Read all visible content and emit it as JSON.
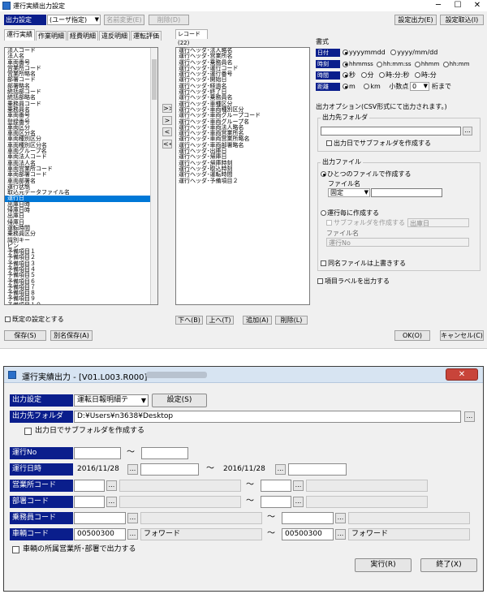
{
  "window1": {
    "title": "運行実績出力設定",
    "toolbar": {
      "output_setting_label": "出力設定",
      "output_setting_value": "(ユーザ指定)",
      "rename_button": "名前変更(E)",
      "delete_button": "削除(D)",
      "output_config_button": "設定出力(E)",
      "import_config_button": "設定取込(I)"
    },
    "tabs": [
      "運行実績",
      "作業明細",
      "経費明細",
      "違反明細",
      "運転評価"
    ],
    "source_list": [
      "法人コード",
      "法人名",
      "車両番号",
      "営業所コード",
      "営業所略名",
      "部署コード",
      "部署略名",
      "統括部コード",
      "統括部略名",
      "乗務員コード",
      "乗務員名",
      "車両番号",
      "登録番号",
      "車両区分",
      "車両区分名",
      "車両種別区分",
      "車両種別区分名",
      "車両グループ名",
      "車両法人コード",
      "車両法人名",
      "車両営業所コード",
      "車両部署コード",
      "車両部署名",
      "運行状態",
      "取込元データファイル名",
      "運行日",
      "出庫日時",
      "帰庫日時",
      "出庫日",
      "帰庫日",
      "運転時間",
      "乗務員区分",
      "識別キー",
      "ピン",
      "予備項目１",
      "予備項目２",
      "予備項目３",
      "予備項目４",
      "予備項目５",
      "予備項目６",
      "予備項目７",
      "予備項目８",
      "予備項目９",
      "予備項目１０",
      "予備数値１",
      "予備数値２",
      "予備数値３"
    ],
    "selected_source_index": 25,
    "selected_header": "レコード(22)",
    "selected_list": [
      "運行ヘッダ･法人略名",
      "運行ヘッダ･営業所名",
      "運行ヘッダ･乗務員名",
      "運行ヘッダ･運行コード",
      "運行ヘッダ･運行番号",
      "運行ヘッダ･開始日",
      "運行ヘッダ･経過名",
      "運行ヘッダ･終了日",
      "運行ヘッダ･乗務員名",
      "運行ヘッダ･車種区分",
      "運行ヘッダ･車両種別区分",
      "運行ヘッダ･車両グループコード",
      "運行ヘッダ･車両グループ名",
      "運行ヘッダ･車両法人略名",
      "運行ヘッダ･車両営業所名",
      "運行ヘッダ･車両営業所略名",
      "運行ヘッダ･車両部署略名",
      "運行ヘッダ･出庫日",
      "運行ヘッダ･帰庫日",
      "運行ヘッダ･帰庫時刻",
      "運行ヘッダ･取込時刻",
      "運行ヘッダ･運転時間",
      "運行ヘッダ･予備項目２"
    ],
    "move_buttons": [
      ">>",
      ">",
      "<",
      "<<"
    ],
    "format": {
      "title": "書式",
      "date_label": "日付",
      "date_options": [
        "yyyymmdd",
        "yyyy/mm/dd"
      ],
      "time_label": "時刻",
      "time_options": [
        "hhmmss",
        "hh:mm:ss",
        "hhmm",
        "hh:mm"
      ],
      "duration_label": "時間",
      "duration_options": [
        "秒",
        "分",
        "時:分:秒",
        "時:分"
      ],
      "distance_label": "距離",
      "distance_options": [
        "m",
        "km"
      ],
      "decimal_label": "小数点",
      "decimal_value": "0",
      "decimal_suffix": "桁まで"
    },
    "output_options_title": "出力オプション(CSV形式にて出力されます。)",
    "output_folder_group": "出力先フォルダ",
    "output_folder_value": "",
    "subfolder_by_date": "出力日でサブフォルダを作成する",
    "output_file_group": "出力ファイル",
    "single_file_radio": "ひとつのファイルで作成する",
    "file_name_label": "ファイル名",
    "file_name_mode": "固定",
    "file_name_value": "",
    "per_trip_radio": "運行毎に作成する",
    "per_trip_subfolder": "サブフォルダを作成する",
    "per_trip_subfolder_value": "出庫日",
    "per_trip_file_name_label": "ファイル名",
    "per_trip_file_name_value": "運行No",
    "overwrite_same_name": "同名ファイルは上書きする",
    "output_item_labels": "項目ラベルを出力する",
    "default_setting": "既定の設定とする",
    "save_button": "保存(S)",
    "save_as_button": "別名保存(A)",
    "down_button": "下へ(B)",
    "up_button": "上へ(T)",
    "add_button": "追加(A)",
    "remove_button": "削除(L)",
    "ok_button": "OK(O)",
    "cancel_button": "キャンセル(C)"
  },
  "window2": {
    "title": "運行実績出力 - [V01.L003.R000]",
    "output_setting_label": "出力設定",
    "output_setting_value": "運転日報明細テ",
    "settings_button": "設定(S)",
    "output_folder_label": "出力先フォルダ",
    "output_folder_value": "D:¥Users¥n3638¥Desktop",
    "subfolder_by_date": "出力日でサブフォルダを作成する",
    "trip_no_label": "運行No",
    "trip_datetime_label": "運行日時",
    "date_from": "2016/11/28",
    "date_to": "2016/11/28",
    "office_code_label": "営業所コード",
    "department_code_label": "部署コード",
    "driver_code_label": "乗務員コード",
    "vehicle_code_label": "車輌コード",
    "vehicle_from": "00500300",
    "vehicle_from_name": "フォワード",
    "vehicle_to": "00500300",
    "vehicle_to_name": "フォワード",
    "vehicle_office_checkbox": "車輌の所属営業所･部署で出力する",
    "execute_button": "実行(R)",
    "exit_button": "終了(X)",
    "tilde": "～",
    "dots": "..."
  }
}
